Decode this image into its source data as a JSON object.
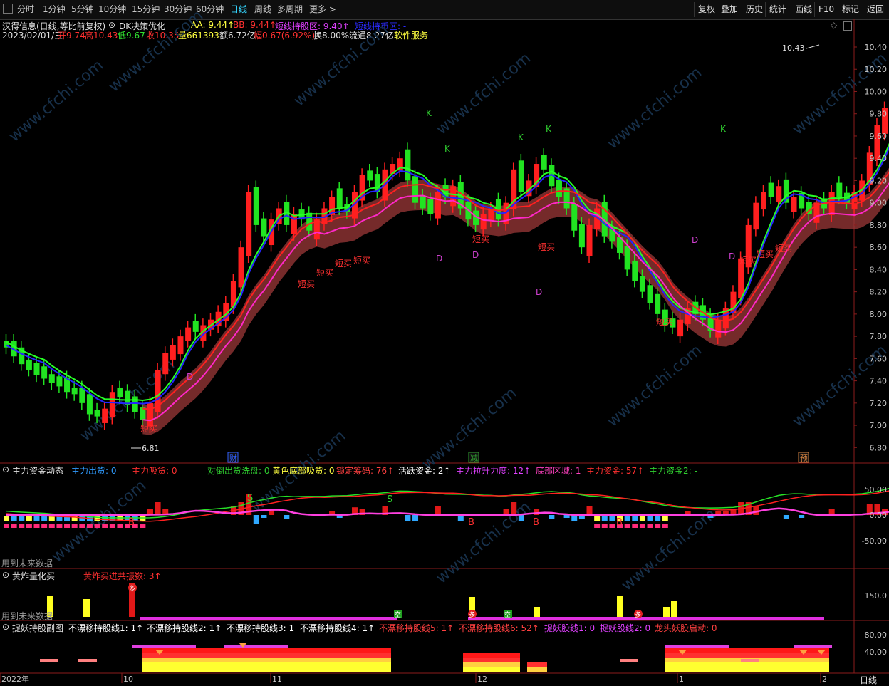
{
  "toolbar": {
    "periods": [
      "分时",
      "1分钟",
      "5分钟",
      "10分钟",
      "15分钟",
      "30分钟",
      "60分钟",
      "日线",
      "周线",
      "多周期",
      "更多 >"
    ],
    "active_period": "日线",
    "right_buttons": [
      "复权",
      "叠加",
      "历史",
      "统计",
      "画线",
      "F10",
      "标记",
      "返回"
    ]
  },
  "header": {
    "stock": "汉得信息(日线,等比前复权)",
    "indicator": "DK决策优化",
    "aa": "AA: 9.44↑",
    "bb": "BB: 9.44↑",
    "short_hold": "短线持股区: 9.40↑",
    "short_hold_coin": "短线持币区: -",
    "date": "2023/02/01/三",
    "open": "开9.74",
    "high": "高10.43",
    "low": "低9.67",
    "close": "收10.35",
    "volume": "量661393",
    "amount": "额6.72亿",
    "change": "幅0.67(6.92%)",
    "turnover": "换8.00%",
    "float": "流通8.27亿",
    "sector": "软件服务"
  },
  "price_axis": [
    "10.40",
    "10.20",
    "10.00",
    "9.80",
    "9.60",
    "9.40",
    "9.20",
    "9.00",
    "8.80",
    "8.60",
    "8.40",
    "8.20",
    "8.00",
    "7.80",
    "7.60",
    "7.40",
    "7.20",
    "7.00",
    "6.80"
  ],
  "price_markers": {
    "high": "10.43",
    "low": "6.81"
  },
  "signals": {
    "short_buy": "短买",
    "k": "K",
    "d": "D",
    "events": [
      "财",
      "减",
      "预"
    ]
  },
  "panel1": {
    "name": "主力资金动态",
    "items": [
      {
        "label": "主力出货: 0",
        "color": "#2f9bff"
      },
      {
        "label": "主力吸货: 0",
        "color": "#ff3030"
      },
      {
        "label": "对倒出货洗盘: 0",
        "color": "#30d030"
      },
      {
        "label": "黄色底部吸货: 0",
        "color": "#ffff40"
      },
      {
        "label": "锁定筹码: 76↑",
        "color": "#ff4040"
      },
      {
        "label": "活跃资金: 2↑",
        "color": "#ffffff"
      },
      {
        "label": "主力拉升力度: 12↑",
        "color": "#e040ff"
      },
      {
        "label": "底部区域: 1",
        "color": "#ff40c0"
      },
      {
        "label": "主力资金: 57↑",
        "color": "#ff3030"
      },
      {
        "label": "主力资金2: -",
        "color": "#30d030"
      }
    ],
    "axis": [
      "50.00",
      "0.00",
      "-50.00"
    ],
    "note": "用到未来数据",
    "marks": [
      "S",
      "B"
    ]
  },
  "panel2": {
    "name": "黄炸量化买",
    "items": [
      {
        "label": "黄炸买进共振数: 3↑",
        "color": "#ff3030"
      }
    ],
    "axis": [
      "150.0"
    ],
    "note": "用到未来数据",
    "marks": [
      "多",
      "空"
    ]
  },
  "panel3": {
    "name": "捉妖持股副图",
    "items": [
      {
        "label": "不漂移持股线1: 1↑",
        "color": "#ffffff"
      },
      {
        "label": "不漂移持股线2: 1↑",
        "color": "#ffffff"
      },
      {
        "label": "不漂移持股线3: 1",
        "color": "#ffffff"
      },
      {
        "label": "不漂移持股线4: 1↑",
        "color": "#ffffff"
      },
      {
        "label": "不漂移持股线5: 1↑",
        "color": "#ff4040"
      },
      {
        "label": "不漂移持股线6: 52↑",
        "color": "#ff4040"
      },
      {
        "label": "捉妖股线1: 0",
        "color": "#e040ff"
      },
      {
        "label": "捉妖股线2: 0",
        "color": "#e040ff"
      },
      {
        "label": "龙头妖股启动: 0",
        "color": "#ff4040"
      }
    ],
    "axis": [
      "80.00",
      "40.00"
    ]
  },
  "time_axis": [
    "2022年",
    "10",
    "11",
    "12",
    "1",
    "2"
  ],
  "bottom_right": "日线",
  "watermark": "www.cfchi.com",
  "colors": {
    "up": "#ff1f1f",
    "down": "#21e421",
    "ma_green": "#26ff26",
    "ma_blue": "#2525ff",
    "ma_pink": "#ff28c8",
    "ma_red": "#ff2020",
    "band": "#9c3838",
    "band_green": "#6ca040"
  }
}
